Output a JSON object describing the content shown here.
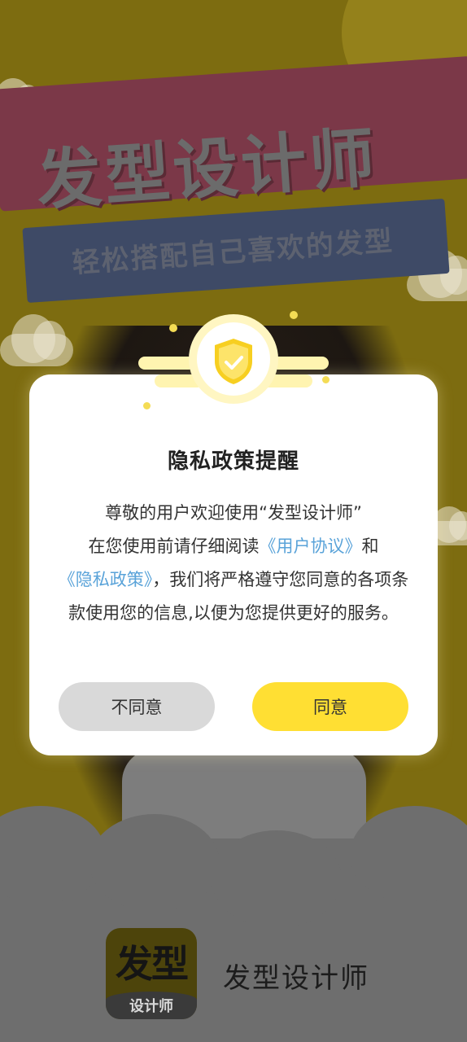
{
  "splash": {
    "banner_title": "发型设计师",
    "banner_subtitle": "轻松搭配自己喜欢的发型",
    "logo_main": "发型",
    "logo_sub": "设计师",
    "app_name": "发型设计师"
  },
  "dialog": {
    "title": "隐私政策提醒",
    "line1": "尊敬的用户欢迎使用“发型设计师”",
    "line2_prefix": "在您使用前请仔细阅读",
    "user_agreement_link": "《用户协议》",
    "line2_suffix": "和",
    "privacy_policy_link": "《隐私政策》",
    "line3_suffix": "，我们将严格遵守您同意的各项条款使用您的信息,以便为您提供更好的服务。",
    "disagree_label": "不同意",
    "agree_label": "同意"
  },
  "icons": {
    "shield": "shield-check-icon"
  },
  "colors": {
    "accent": "#ffdf33",
    "link": "#5aa3d9",
    "disagree": "#d9d9d9"
  }
}
